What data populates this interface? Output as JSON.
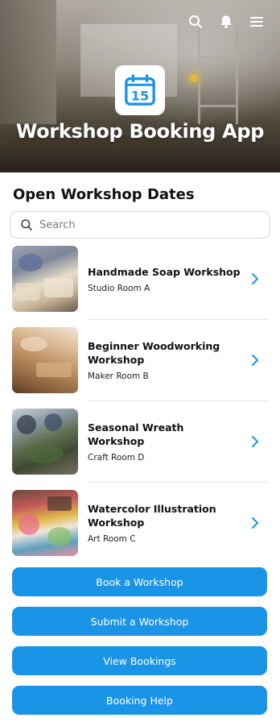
{
  "header": {
    "app_title": "Workshop Booking App",
    "icons": [
      "search-icon",
      "bell-icon",
      "menu-icon"
    ],
    "app_icon_number": "15"
  },
  "section": {
    "title": "Open Workshop Dates"
  },
  "search": {
    "placeholder": "Search"
  },
  "workshops": [
    {
      "name": "Handmade Soap Workshop",
      "room": "Studio Room A",
      "thumbnail": "soap-photo"
    },
    {
      "name": "Beginner Woodworking Workshop",
      "room": "Maker Room B",
      "thumbnail": "woodworking-photo"
    },
    {
      "name": "Seasonal Wreath Workshop",
      "room": "Craft Room D",
      "thumbnail": "wreath-photo"
    },
    {
      "name": "Watercolor Illustration Workshop",
      "room": "Art Room C",
      "thumbnail": "watercolor-photo"
    }
  ],
  "actions": {
    "book": "Book a Workshop",
    "submit": "Submit a Workshop",
    "view": "View Bookings",
    "help": "Booking Help"
  },
  "colors": {
    "accent": "#1a94e6",
    "text": "#111111"
  }
}
